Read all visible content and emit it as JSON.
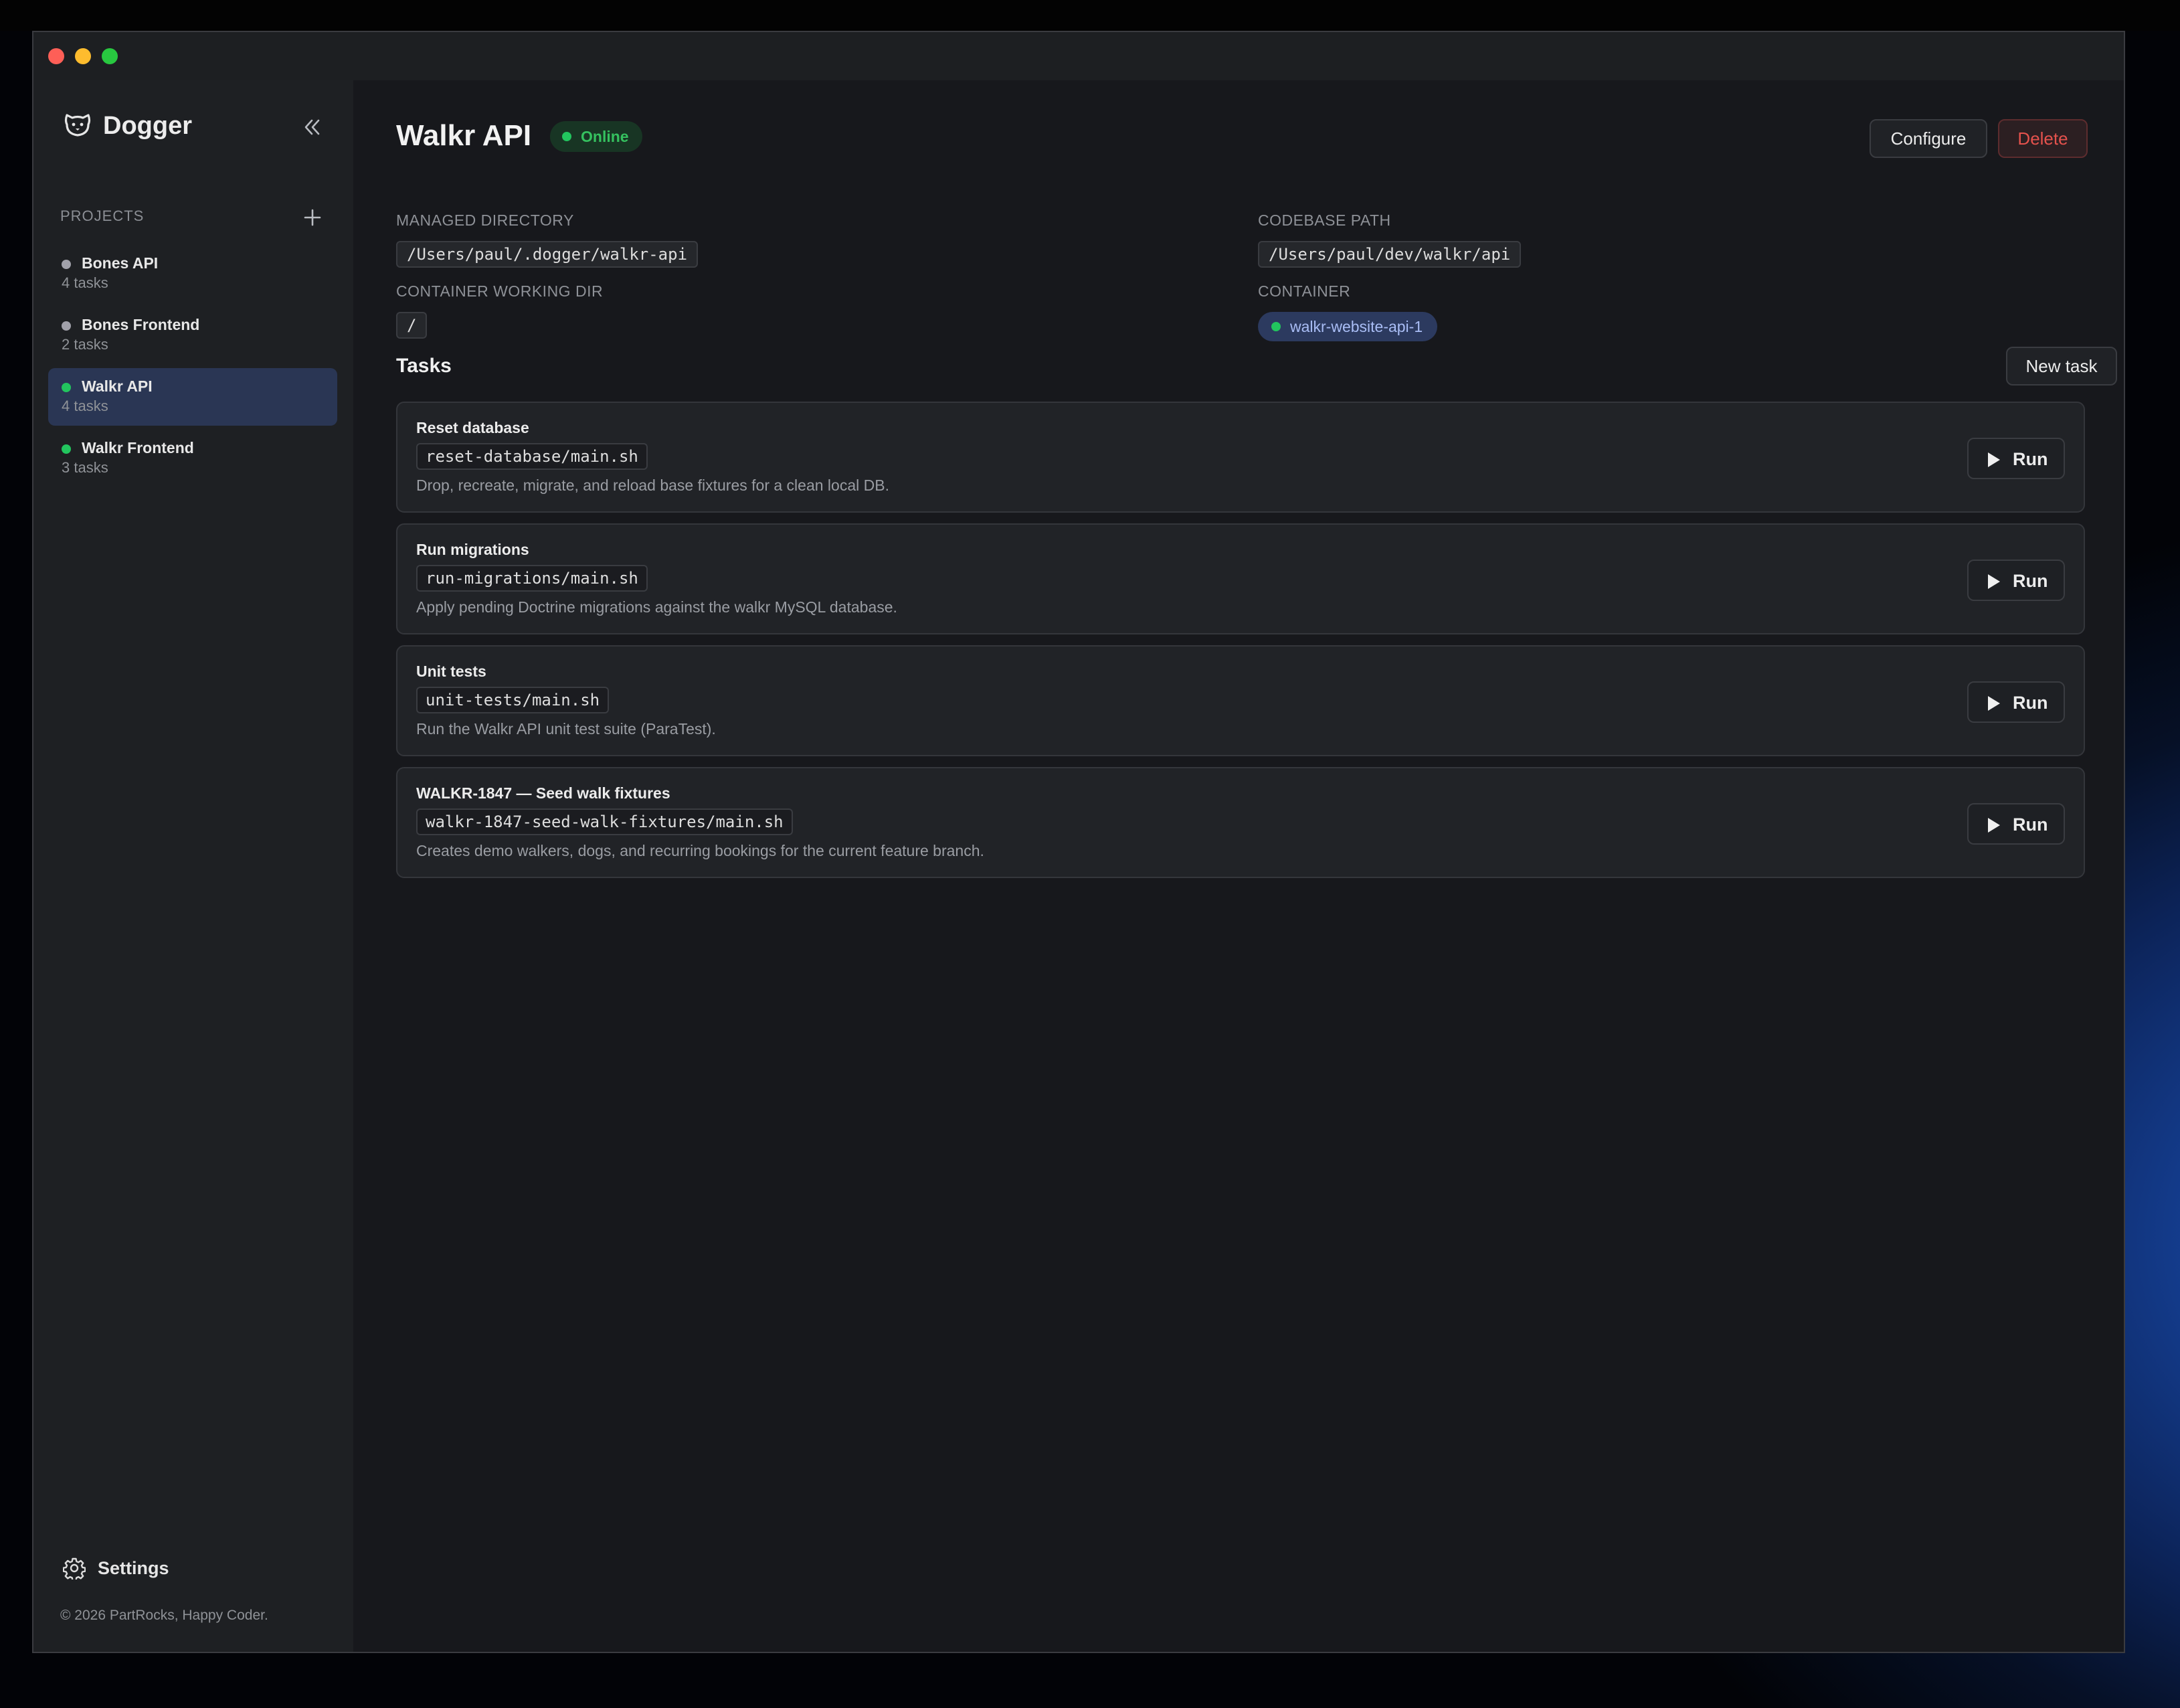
{
  "app": {
    "name": "Dogger"
  },
  "sidebar": {
    "section_label": "PROJECTS",
    "projects": [
      {
        "name": "Bones API",
        "tasks": "4 tasks",
        "status": "offline",
        "active": false
      },
      {
        "name": "Bones Frontend",
        "tasks": "2 tasks",
        "status": "offline",
        "active": false
      },
      {
        "name": "Walkr API",
        "tasks": "4 tasks",
        "status": "online",
        "active": true
      },
      {
        "name": "Walkr Frontend",
        "tasks": "3 tasks",
        "status": "online",
        "active": false
      }
    ],
    "settings_label": "Settings",
    "copyright": "© 2026 PartRocks, Happy Coder."
  },
  "project": {
    "title": "Walkr API",
    "status": "Online",
    "configure_label": "Configure",
    "delete_label": "Delete",
    "managed_directory_label": "MANAGED DIRECTORY",
    "managed_directory": "/Users/paul/.dogger/walkr-api",
    "codebase_path_label": "CODEBASE PATH",
    "codebase_path": "/Users/paul/dev/walkr/api",
    "container_working_dir_label": "CONTAINER WORKING DIR",
    "container_working_dir": "/",
    "container_label": "CONTAINER",
    "container": "walkr-website-api-1"
  },
  "tasks": {
    "title": "Tasks",
    "new_task_label": "New task",
    "run_label": "Run",
    "items": [
      {
        "name": "Reset database",
        "script": "reset-database/main.sh",
        "description": "Drop, recreate, migrate, and reload base fixtures for a clean local DB."
      },
      {
        "name": "Run migrations",
        "script": "run-migrations/main.sh",
        "description": "Apply pending Doctrine migrations against the walkr MySQL database."
      },
      {
        "name": "Unit tests",
        "script": "unit-tests/main.sh",
        "description": "Run the Walkr API unit test suite (ParaTest)."
      },
      {
        "name": "WALKR-1847 — Seed walk fixtures",
        "script": "walkr-1847-seed-walk-fixtures/main.sh",
        "description": "Creates demo walkers, dogs, and recurring bookings for the current feature branch."
      }
    ]
  },
  "colors": {
    "status_online": "#22c55e",
    "status_offline": "#a1a1aa",
    "active_project_bg": "#2a3654",
    "delete_text": "#e5524d"
  },
  "icons": {
    "brand": "dog-face-icon",
    "collapse": "chevrons-left-icon",
    "add": "plus-icon",
    "settings": "gear-icon",
    "run": "play-icon"
  }
}
